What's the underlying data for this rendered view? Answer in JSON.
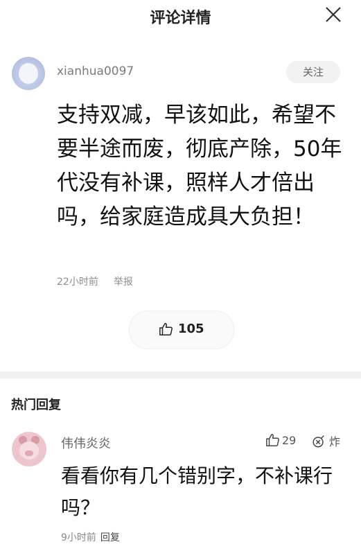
{
  "header": {
    "title": "评论详情",
    "close_icon": "close-icon"
  },
  "comment": {
    "username": "xianhua0097",
    "follow_label": "关注",
    "text": "支持双减，早该如此，希望不要半途而废，彻底产除，50年代没有补课，照样人才倍出吗，给家庭造成具大负担！",
    "time": "22小时前",
    "report_label": "举报",
    "like_count": "105"
  },
  "section": {
    "hot_replies_title": "热门回复"
  },
  "reply": {
    "username": "伟伟炎炎",
    "like_count": "29",
    "bomb_label": "炸",
    "text": "看看你有几个错别字，不补课行吗？",
    "time": "9小时前",
    "reply_label": "回复"
  },
  "colors": {
    "background": "#ffffff",
    "divider": "#f0f0f0",
    "muted_text": "#8e8e8e"
  }
}
